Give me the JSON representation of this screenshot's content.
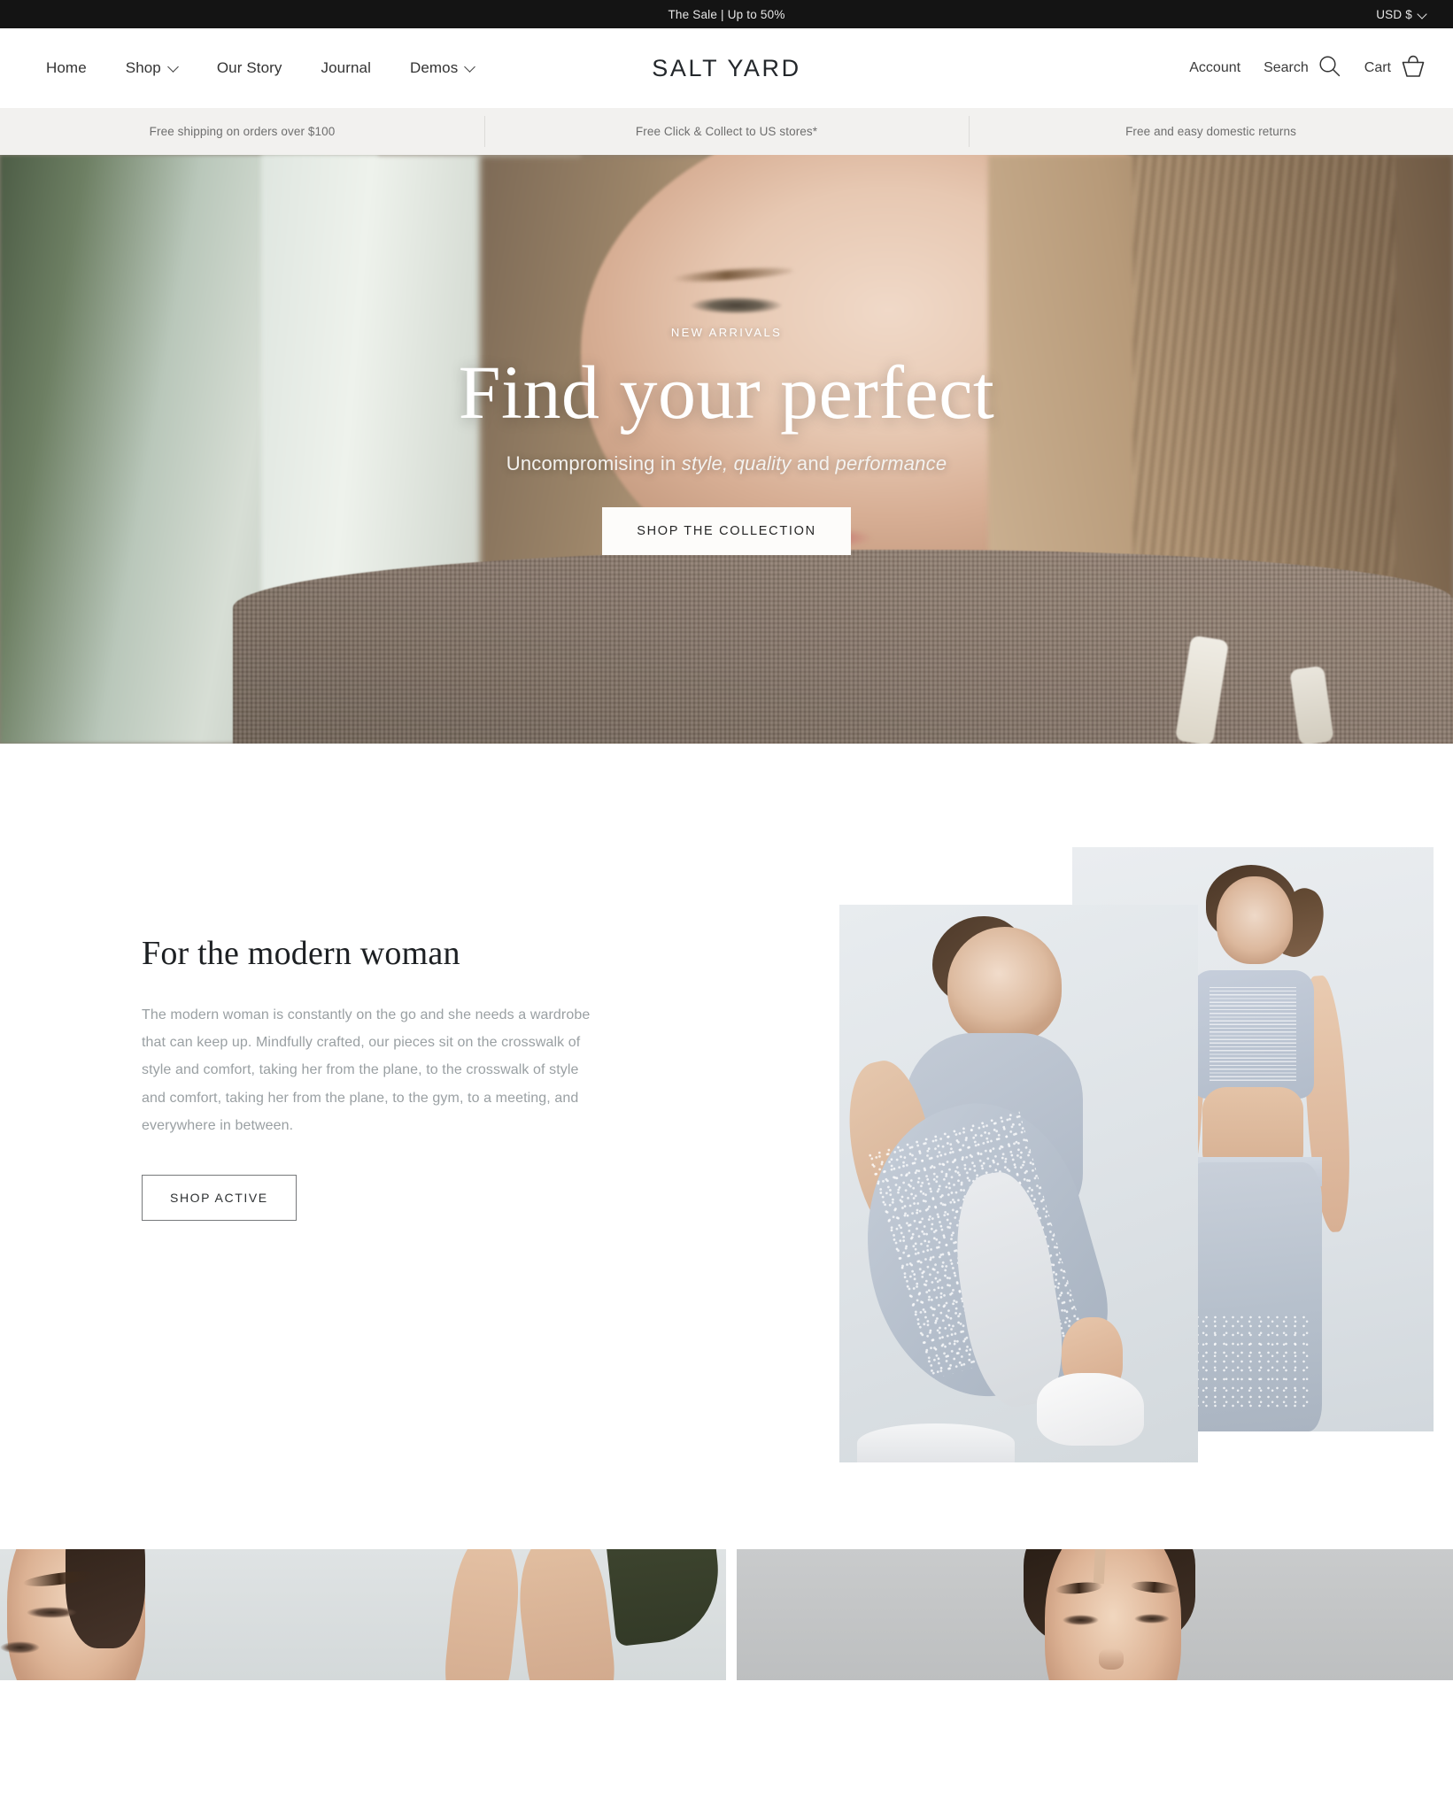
{
  "announcement": {
    "text": "The Sale | Up to 50%",
    "currency": "USD $",
    "currency_icon": "chevron-down-icon"
  },
  "header": {
    "logo": "SALT YARD",
    "nav": [
      {
        "label": "Home",
        "has_dropdown": false
      },
      {
        "label": "Shop",
        "has_dropdown": true
      },
      {
        "label": "Our Story",
        "has_dropdown": false
      },
      {
        "label": "Journal",
        "has_dropdown": false
      },
      {
        "label": "Demos",
        "has_dropdown": true
      }
    ],
    "account_label": "Account",
    "search_label": "Search",
    "search_icon": "search-icon",
    "cart_label": "Cart",
    "cart_icon": "basket-icon"
  },
  "benefits": [
    {
      "text": "Free shipping on orders over $100"
    },
    {
      "text": "Free Click & Collect to US stores*"
    },
    {
      "text": "Free and easy domestic returns"
    }
  ],
  "hero": {
    "eyebrow": "NEW ARRIVALS",
    "title": "Find your perfect",
    "subtitle_pre": "Uncompromising in ",
    "subtitle_em1": "style, quality",
    "subtitle_mid": " and ",
    "subtitle_em2": "performance",
    "cta": "SHOP THE COLLECTION"
  },
  "modern_woman": {
    "title": "For the modern woman",
    "body": "The modern woman is constantly on the go and she needs a wardrobe that can keep up. Mindfully crafted, our pieces sit on the crosswalk of style and comfort, taking her from the plane, to the crosswalk of style and comfort, taking her from the plane, to the gym, to a meeting, and everywhere in between.",
    "cta": "SHOP ACTIVE",
    "image_front_alt": "seated-model-grey-activewear",
    "image_back_alt": "back-view-model-grey-sports-bra"
  },
  "tiles": [
    {
      "alt": "model-portrait-left"
    },
    {
      "alt": "model-legs-olive-shorts"
    },
    {
      "alt": "model-portrait-right"
    }
  ],
  "colors": {
    "announcement_bg": "#141414",
    "benefits_bg": "#f2f1ef",
    "text_dark": "#2b2b2b",
    "body_grey": "#9aa0a3",
    "button_light": "#fdfcfa"
  }
}
